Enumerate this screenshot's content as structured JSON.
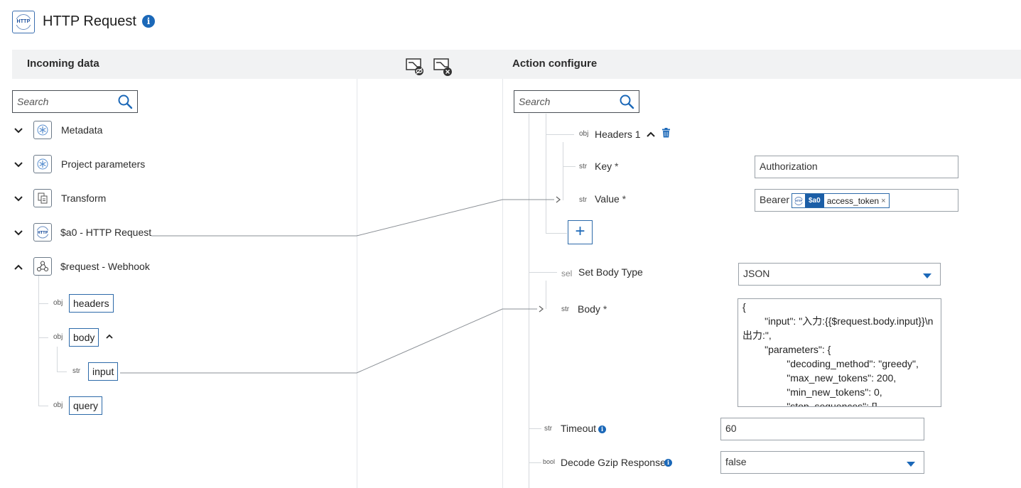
{
  "header": {
    "title": "HTTP Request",
    "icon_tag": "HTTP",
    "info_glyph": "i"
  },
  "incoming": {
    "title": "Incoming data",
    "search_placeholder": "Search",
    "nodes": [
      {
        "label": "Metadata",
        "icon": "flower-icon",
        "expanded": false
      },
      {
        "label": "Project parameters",
        "icon": "flower-icon",
        "expanded": false
      },
      {
        "label": "Transform",
        "icon": "transform-icon",
        "expanded": false
      },
      {
        "label": "$a0 - HTTP Request",
        "icon": "http-globe-icon",
        "expanded": false
      },
      {
        "label": "$request - Webhook",
        "icon": "webhook-icon",
        "expanded": true
      }
    ],
    "children": [
      {
        "type": "obj",
        "label": "headers"
      },
      {
        "type": "obj",
        "label": "body"
      },
      {
        "type": "str",
        "label": "input"
      },
      {
        "type": "obj",
        "label": "query"
      }
    ]
  },
  "action": {
    "title": "Action configure",
    "search_placeholder": "Search",
    "headers_group": {
      "type": "obj",
      "label": "Headers 1"
    },
    "key": {
      "type": "str",
      "label": "Key",
      "required": "*",
      "value": "Authorization"
    },
    "value": {
      "type": "str",
      "label": "Value",
      "required": "*",
      "prefix": "Bearer",
      "chip_ref": "$a0",
      "chip_name": "access_token",
      "chip_close": "×"
    },
    "add_glyph": "+",
    "body_type": {
      "type": "sel",
      "label": "Set Body Type",
      "value": "JSON"
    },
    "body": {
      "type": "str",
      "label": "Body",
      "required": "*",
      "value": "{\n        \"input\": \"入力:{{$request.body.input}}\\n\n出力:\",\n        \"parameters\": {\n                \"decoding_method\": \"greedy\",\n                \"max_new_tokens\": 200,\n                \"min_new_tokens\": 0,\n                \"stop_sequences\": []"
    },
    "timeout": {
      "type": "str",
      "label": "Timeout",
      "value": "60"
    },
    "gzip": {
      "type": "bool",
      "label": "Decode Gzip Response",
      "value": "false"
    }
  },
  "colors": {
    "accent": "#1b68b8",
    "bar": "#f1f2f3",
    "border_blue": "#2d6aa9"
  }
}
